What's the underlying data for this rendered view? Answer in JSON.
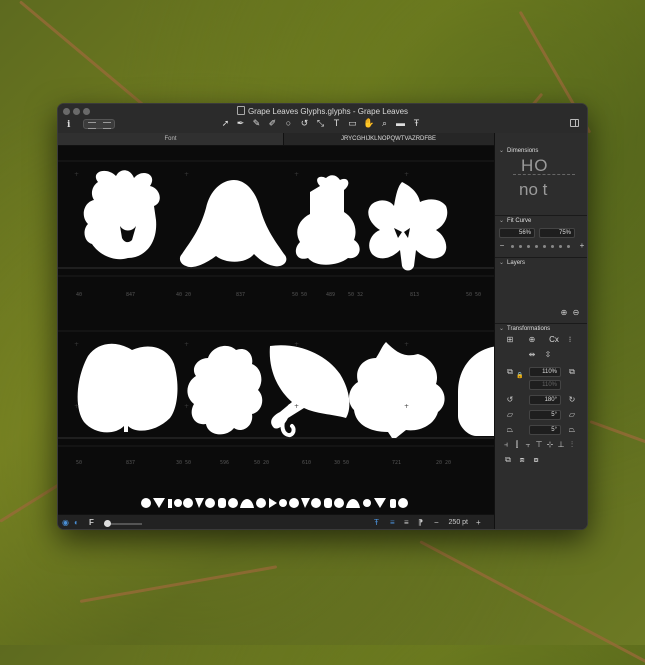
{
  "window": {
    "title": "Grape Leaves Glyphs.glyphs - Grape Leaves",
    "info_label": "i"
  },
  "toolbar": {
    "tools": [
      "select-tool",
      "pen-tool",
      "pencil-tool",
      "brush-tool",
      "knife-tool",
      "ellipse-tool",
      "rotate-tool",
      "scale-tool",
      "text-tool",
      "annotation-tool",
      "hand-tool",
      "zoom-tool",
      "measure-tool",
      "type-tool"
    ]
  },
  "tabs": {
    "font": "Font",
    "glyphs": "JRYCGHIJKLNOPQWTVAZRDFBE"
  },
  "canvas": {
    "row1_metrics": [
      "40",
      "847",
      "40 20",
      "837",
      "50 50",
      "489",
      "50 32",
      "813",
      "50 50"
    ],
    "row2_metrics": [
      "50",
      "837",
      "30 50",
      "596",
      "50 20",
      "610",
      "30 50",
      "721",
      "20 20"
    ]
  },
  "status": {
    "zoom_value": "250 pt",
    "minus_label": "−",
    "plus_label": "+",
    "f_label": "F"
  },
  "panel": {
    "dimensions": {
      "header": "Dimensions",
      "preview_top": "HO",
      "preview_bottom": "no t"
    },
    "fit_curve": {
      "header": "Fit Curve",
      "left_value": "56%",
      "right_value": "75%",
      "minus": "−",
      "plus": "+"
    },
    "layers": {
      "header": "Layers"
    },
    "transformations": {
      "header": "Transformations",
      "scale_value": "110%",
      "scale_value_2": "110%",
      "rotate_value": "180°",
      "slant_value_1": "5°",
      "slant_value_2": "5°"
    }
  }
}
